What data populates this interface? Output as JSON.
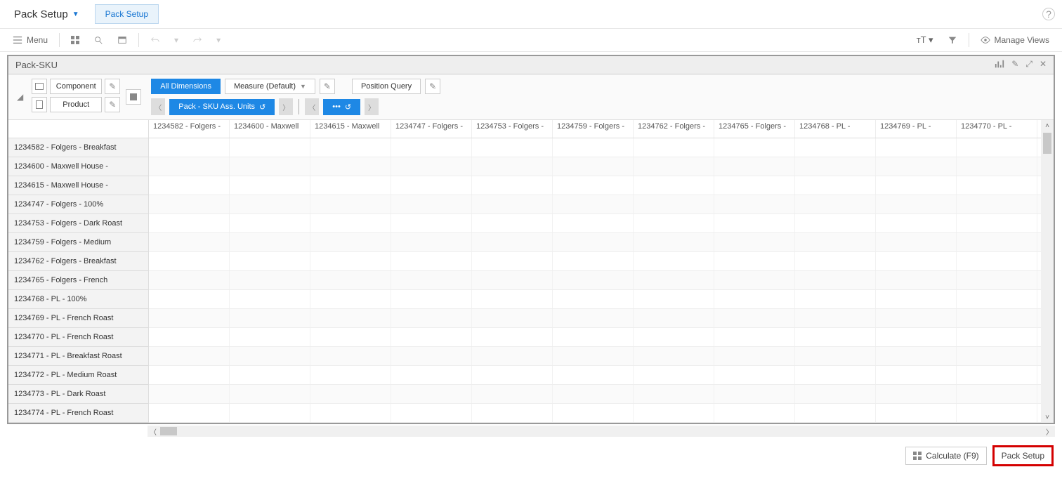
{
  "header": {
    "title": "Pack Setup",
    "tab": "Pack Setup"
  },
  "toolbar": {
    "menu": "Menu",
    "manage_views": "Manage Views"
  },
  "view": {
    "title": "Pack-SKU"
  },
  "dims": {
    "row1": "Component",
    "row2": "Product",
    "all": "All Dimensions",
    "measure": "Measure (Default)",
    "pos_query": "Position Query",
    "pack_btn": "Pack - SKU Ass. Units",
    "dots": "•••"
  },
  "columns": [
    "1234582 - Folgers -",
    "1234600 - Maxwell",
    "1234615 - Maxwell",
    "1234747 - Folgers -",
    "1234753 - Folgers -",
    "1234759 - Folgers -",
    "1234762 - Folgers -",
    "1234765 - Folgers -",
    "1234768 - PL -",
    "1234769 - PL -",
    "1234770 - PL -"
  ],
  "rows": [
    "1234582 - Folgers - Breakfast",
    "1234600 - Maxwell House -",
    "1234615 - Maxwell House -",
    "1234747 - Folgers - 100%",
    "1234753 - Folgers - Dark Roast",
    "1234759 - Folgers - Medium",
    "1234762 - Folgers - Breakfast",
    "1234765 - Folgers - French",
    "1234768 - PL - 100%",
    "1234769 - PL - French Roast",
    "1234770 - PL - French Roast",
    "1234771 - PL - Breakfast Roast",
    "1234772 - PL - Medium Roast",
    "1234773 - PL - Dark Roast",
    "1234774 - PL - French Roast"
  ],
  "footer": {
    "calc": "Calculate (F9)",
    "pack": "Pack Setup"
  }
}
